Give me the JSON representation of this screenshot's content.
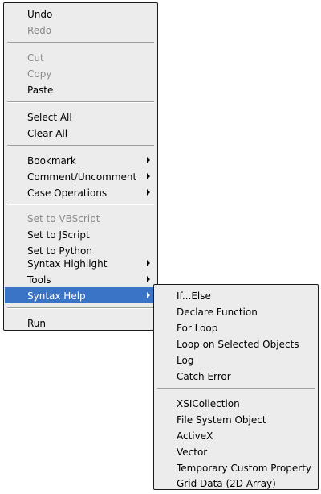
{
  "main_menu": {
    "undo": "Undo",
    "redo": "Redo",
    "cut": "Cut",
    "copy": "Copy",
    "paste": "Paste",
    "select_all": "Select All",
    "clear_all": "Clear All",
    "bookmark": "Bookmark",
    "comment_uncomment": "Comment/Uncomment",
    "case_operations": "Case Operations",
    "set_to_vbscript": "Set to VBScript",
    "set_to_jscript": "Set to JScript",
    "set_to_python": "Set to Python",
    "syntax_highlight": "Syntax Highlight",
    "tools": "Tools",
    "syntax_help": "Syntax Help",
    "run": "Run"
  },
  "syntax_help_submenu": {
    "if_else": "If...Else",
    "declare_function": "Declare Function",
    "for_loop": "For Loop",
    "loop_on_selected_objects": "Loop on Selected Objects",
    "log": "Log",
    "catch_error": "Catch Error",
    "xsi_collection": "XSICollection",
    "file_system_object": "File System Object",
    "activex": "ActiveX",
    "vector": "Vector",
    "temporary_custom_property": "Temporary Custom Property",
    "grid_data": "Grid Data (2D Array)"
  },
  "colors": {
    "menu_background": "#ececec",
    "highlight": "#3a74c7",
    "disabled_text": "#8a8a8a"
  }
}
